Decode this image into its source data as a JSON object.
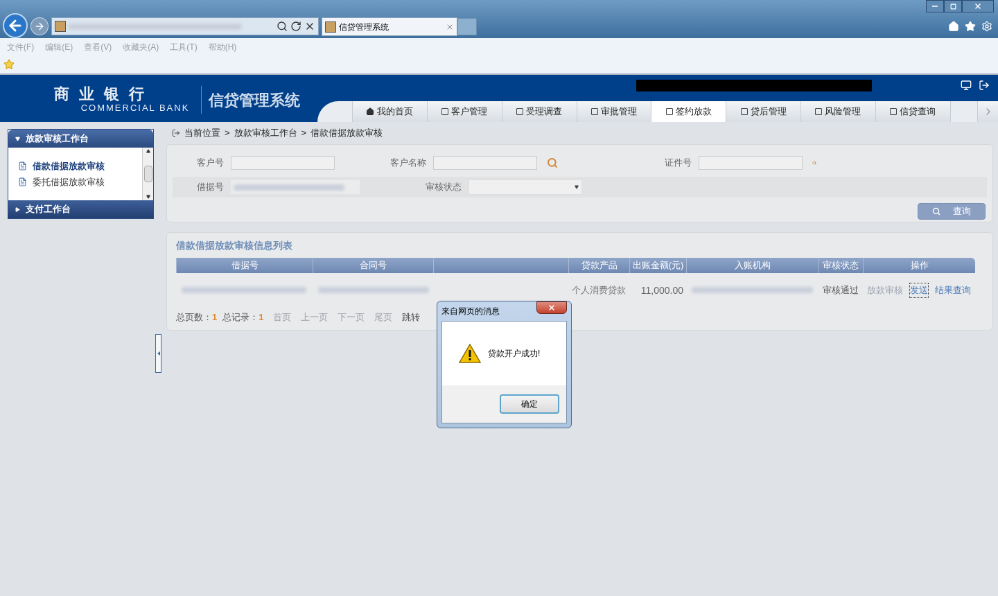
{
  "browser": {
    "tab_title": "信贷管理系统",
    "menu": [
      "文件(F)",
      "编辑(E)",
      "查看(V)",
      "收藏夹(A)",
      "工具(T)",
      "帮助(H)"
    ]
  },
  "header": {
    "logo_cn": "商 业 银 行",
    "logo_en": "COMMERCIAL BANK",
    "system": "信贷管理系统",
    "nav": [
      {
        "label": "我的首页",
        "selected": false
      },
      {
        "label": "客户管理",
        "selected": false
      },
      {
        "label": "受理调查",
        "selected": false
      },
      {
        "label": "审批管理",
        "selected": false
      },
      {
        "label": "签约放款",
        "selected": true
      },
      {
        "label": "贷后管理",
        "selected": false
      },
      {
        "label": "风险管理",
        "selected": false
      },
      {
        "label": "信贷查询",
        "selected": false
      }
    ]
  },
  "sidebar": {
    "groups": [
      {
        "title": "放款审核工作台",
        "expanded": true,
        "items": [
          {
            "label": "借款借据放款审核",
            "selected": true
          },
          {
            "label": "委托借据放款审核",
            "selected": false
          }
        ]
      },
      {
        "title": "支付工作台",
        "expanded": false
      }
    ]
  },
  "breadcrumb": {
    "items": [
      "当前位置",
      "放款审核工作台",
      "借款借据放款审核"
    ],
    "separator": ">"
  },
  "search": {
    "fields": [
      {
        "label": "客户号",
        "kind": "text"
      },
      {
        "label": "客户名称",
        "kind": "lookup"
      },
      {
        "label": "证件号",
        "kind": "lookup"
      },
      {
        "label": "借据号",
        "kind": "blurred"
      },
      {
        "label": "审核状态",
        "kind": "select"
      }
    ],
    "button": "查询"
  },
  "list": {
    "title": "借款借据放款审核信息列表",
    "columns": [
      "借据号",
      "合同号",
      "贷款产品",
      "出账金额(元)",
      "入账机构",
      "审核状态",
      "操作"
    ],
    "rows": [
      {
        "product": "个人消费贷款",
        "amount": "11,000.00",
        "status": "审核通过",
        "actions": [
          {
            "label": "放款审核",
            "disabled": true,
            "focused": false
          },
          {
            "label": "发送",
            "disabled": false,
            "focused": true
          },
          {
            "label": "结果查询",
            "disabled": false,
            "focused": false
          }
        ]
      }
    ],
    "pagination": {
      "pages_label": "总页数：",
      "pages": "1",
      "records_label": "总记录：",
      "records": "1",
      "links": [
        {
          "label": "首页",
          "disabled": true
        },
        {
          "label": "上一页",
          "disabled": true
        },
        {
          "label": "下一页",
          "disabled": true
        },
        {
          "label": "尾页",
          "disabled": true
        }
      ],
      "jump": "跳转"
    }
  },
  "dialog": {
    "title": "来自网页的消息",
    "message": "贷款开户成功!",
    "ok": "确定"
  }
}
